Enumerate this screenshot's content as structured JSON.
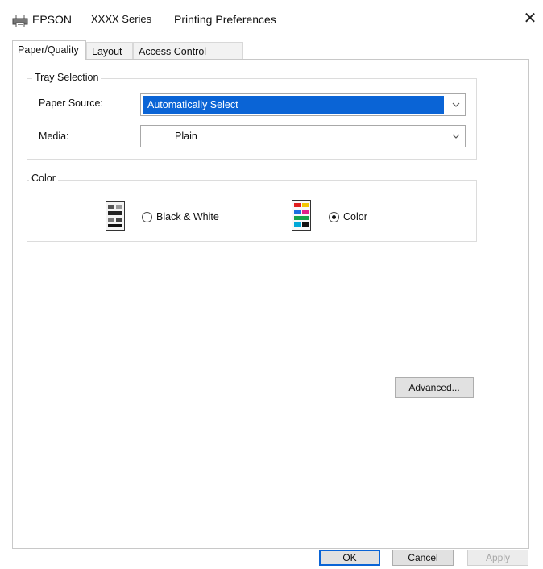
{
  "window": {
    "brand": "EPSON",
    "series": "XXXX Series",
    "title": "Printing Preferences",
    "close_glyph": "✕"
  },
  "tabs": [
    {
      "label": "Paper/Quality",
      "active": true
    },
    {
      "label": "Layout",
      "active": false
    },
    {
      "label": "Access Control Settings",
      "active": false
    }
  ],
  "tray_selection": {
    "legend": "Tray Selection",
    "paper_source_label": "Paper Source:",
    "paper_source_value": "Automatically Select",
    "media_label": "Media:",
    "media_value": "Plain"
  },
  "color": {
    "legend": "Color",
    "options": [
      {
        "label": "Black & White",
        "selected": false,
        "icon": "grayscale-document-icon"
      },
      {
        "label": "Color",
        "selected": true,
        "icon": "color-document-icon"
      }
    ]
  },
  "advanced_label": "Advanced...",
  "footer": {
    "ok_label": "OK",
    "cancel_label": "Cancel",
    "apply_label": "Apply"
  },
  "colors": {
    "accent": "#0a64d6",
    "panel_border": "#c8c8c8"
  }
}
